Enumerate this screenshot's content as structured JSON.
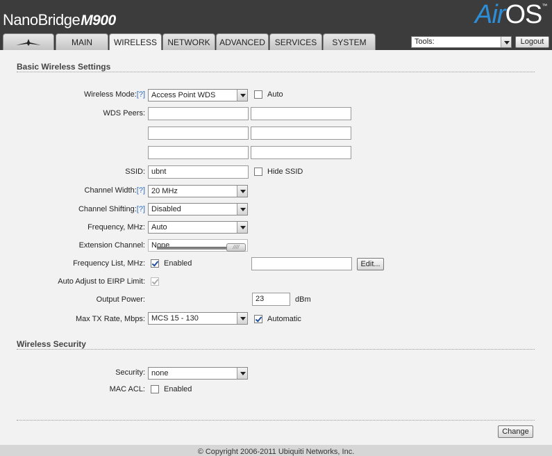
{
  "header": {
    "brand": "NanoBridge",
    "model": "M900",
    "logo_air": "Air",
    "logo_os": "OS",
    "logo_tm": "™"
  },
  "tabs": [
    {
      "label": "",
      "icon": "ubiquiti-logo-icon"
    },
    {
      "label": "MAIN"
    },
    {
      "label": "WIRELESS",
      "active": true
    },
    {
      "label": "NETWORK"
    },
    {
      "label": "ADVANCED"
    },
    {
      "label": "SERVICES"
    },
    {
      "label": "SYSTEM"
    }
  ],
  "tools": {
    "value": "Tools:"
  },
  "logout_label": "Logout",
  "basic": {
    "title": "Basic Wireless Settings",
    "wireless_mode": {
      "label": "Wireless Mode:",
      "help": "[?]",
      "value": "Access Point WDS",
      "auto_label": "Auto",
      "auto_checked": false
    },
    "wds_peers": {
      "label": "WDS Peers:",
      "values": [
        "",
        "",
        "",
        "",
        "",
        ""
      ]
    },
    "ssid": {
      "label": "SSID:",
      "value": "ubnt",
      "hide_label": "Hide SSID",
      "hide_checked": false
    },
    "channel_width": {
      "label": "Channel Width:",
      "help": "[?]",
      "value": "20 MHz"
    },
    "channel_shifting": {
      "label": "Channel Shifting:",
      "help": "[?]",
      "value": "Disabled"
    },
    "frequency": {
      "label": "Frequency, MHz:",
      "value": "Auto"
    },
    "extension_channel": {
      "label": "Extension Channel:",
      "value": "None"
    },
    "frequency_list": {
      "label": "Frequency List, MHz:",
      "enabled_label": "Enabled",
      "enabled_checked": true,
      "value": "",
      "edit_label": "Edit..."
    },
    "auto_adjust": {
      "label": "Auto Adjust to EIRP Limit:",
      "checked": true
    },
    "output_power": {
      "label": "Output Power:",
      "value": "23",
      "unit": "dBm",
      "slider_grip": "////"
    },
    "max_tx_rate": {
      "label": "Max TX Rate, Mbps:",
      "value": "MCS 15 - 130",
      "automatic_label": "Automatic",
      "automatic_checked": true
    }
  },
  "security": {
    "title": "Wireless Security",
    "security": {
      "label": "Security:",
      "value": "none"
    },
    "mac_acl": {
      "label": "MAC ACL:",
      "enabled_label": "Enabled",
      "enabled_checked": false
    }
  },
  "change_label": "Change",
  "footer": "© Copyright 2006-2011 Ubiquiti Networks, Inc."
}
